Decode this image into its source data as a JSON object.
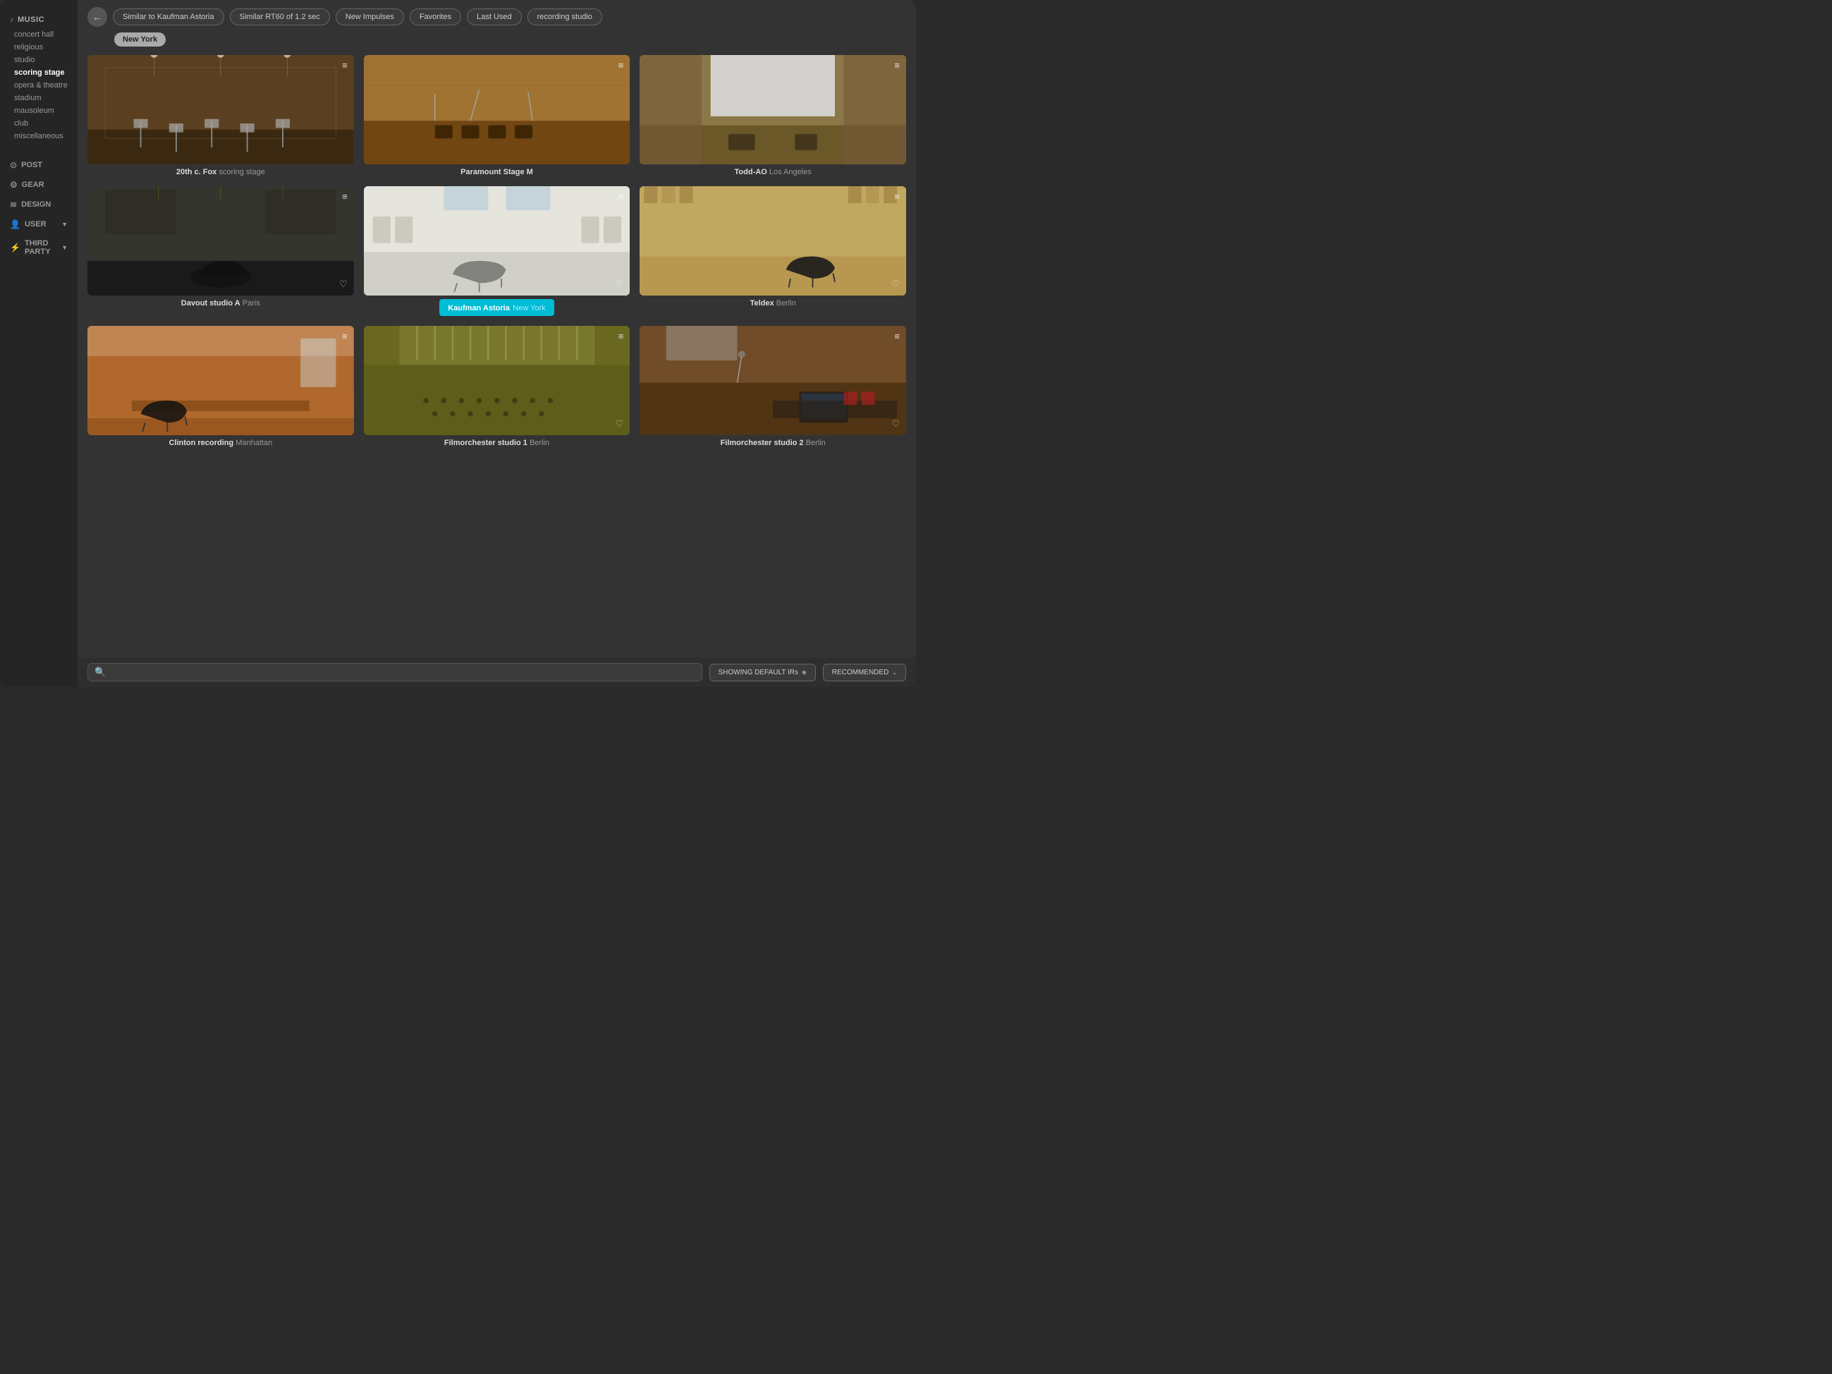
{
  "sidebar": {
    "music_label": "MUSIC",
    "music_icon": "♪",
    "items": [
      {
        "id": "concert-hall",
        "label": "concert hall",
        "active": false
      },
      {
        "id": "religious",
        "label": "religious",
        "active": false
      },
      {
        "id": "studio",
        "label": "studio",
        "active": false
      },
      {
        "id": "scoring-stage",
        "label": "scoring stage",
        "active": true
      },
      {
        "id": "opera-theatre",
        "label": "opera & theatre",
        "active": false
      },
      {
        "id": "stadium",
        "label": "stadium",
        "active": false
      },
      {
        "id": "mausoleum",
        "label": "mausoleum",
        "active": false
      },
      {
        "id": "club",
        "label": "club",
        "active": false
      },
      {
        "id": "miscellaneous",
        "label": "miscellaneous",
        "active": false
      }
    ],
    "nav_items": [
      {
        "id": "post",
        "label": "POST",
        "icon": "⊙"
      },
      {
        "id": "gear",
        "label": "GEAR",
        "icon": "⚙"
      },
      {
        "id": "design",
        "label": "DESIGN",
        "icon": "≋"
      },
      {
        "id": "user",
        "label": "USER",
        "icon": "👤",
        "has_chevron": true
      },
      {
        "id": "third-party",
        "label": "THIRD PARTY",
        "icon": "⚡",
        "has_chevron": true
      }
    ]
  },
  "filter_bar": {
    "back_label": "←",
    "tags": [
      {
        "id": "similar-kaufman",
        "label": "Similar to Kaufman Astoria",
        "active": false
      },
      {
        "id": "similar-rt60",
        "label": "Similar RT60 of 1.2 sec",
        "active": false
      },
      {
        "id": "new-impulses",
        "label": "New Impulses",
        "active": false
      },
      {
        "id": "favorites",
        "label": "Favorites",
        "active": false
      },
      {
        "id": "last-used",
        "label": "Last Used",
        "active": false
      },
      {
        "id": "recording-studio",
        "label": "recording studio",
        "active": false
      }
    ],
    "location": "New York"
  },
  "venues": [
    {
      "id": "20th-fox",
      "name": "20th c. Fox",
      "sub": "scoring stage",
      "room_class": "room-1",
      "selected": false
    },
    {
      "id": "paramount-stage-m",
      "name": "Paramount Stage M",
      "sub": "",
      "room_class": "room-2",
      "selected": false
    },
    {
      "id": "todd-ao",
      "name": "Todd-AO",
      "sub": "Los Angeles",
      "room_class": "room-3",
      "selected": false
    },
    {
      "id": "davout-studio-a",
      "name": "Davout studio A",
      "sub": "Paris",
      "room_class": "room-4",
      "selected": false
    },
    {
      "id": "kaufman-astoria",
      "name": "Kaufman Astoria",
      "sub": "New York",
      "room_class": "room-5",
      "selected": true
    },
    {
      "id": "teldex",
      "name": "Teldex",
      "sub": "Berlin",
      "room_class": "room-6",
      "selected": false
    },
    {
      "id": "clinton-recording",
      "name": "Clinton recording",
      "sub": "Manhattan",
      "room_class": "room-7",
      "selected": false
    },
    {
      "id": "filmorchester-1",
      "name": "Filmorchester studio 1",
      "sub": "Berlin",
      "room_class": "room-8",
      "selected": false
    },
    {
      "id": "filmorchester-2",
      "name": "Filmorchester studio 2",
      "sub": "Berlin",
      "room_class": "room-9",
      "selected": false
    }
  ],
  "bottom_bar": {
    "search_placeholder": "",
    "showing_label": "SHOWING DEFAULT IRs",
    "showing_icon": "⊕",
    "recommended_label": "RECOMMENDED",
    "recommended_icon": "⌄"
  }
}
